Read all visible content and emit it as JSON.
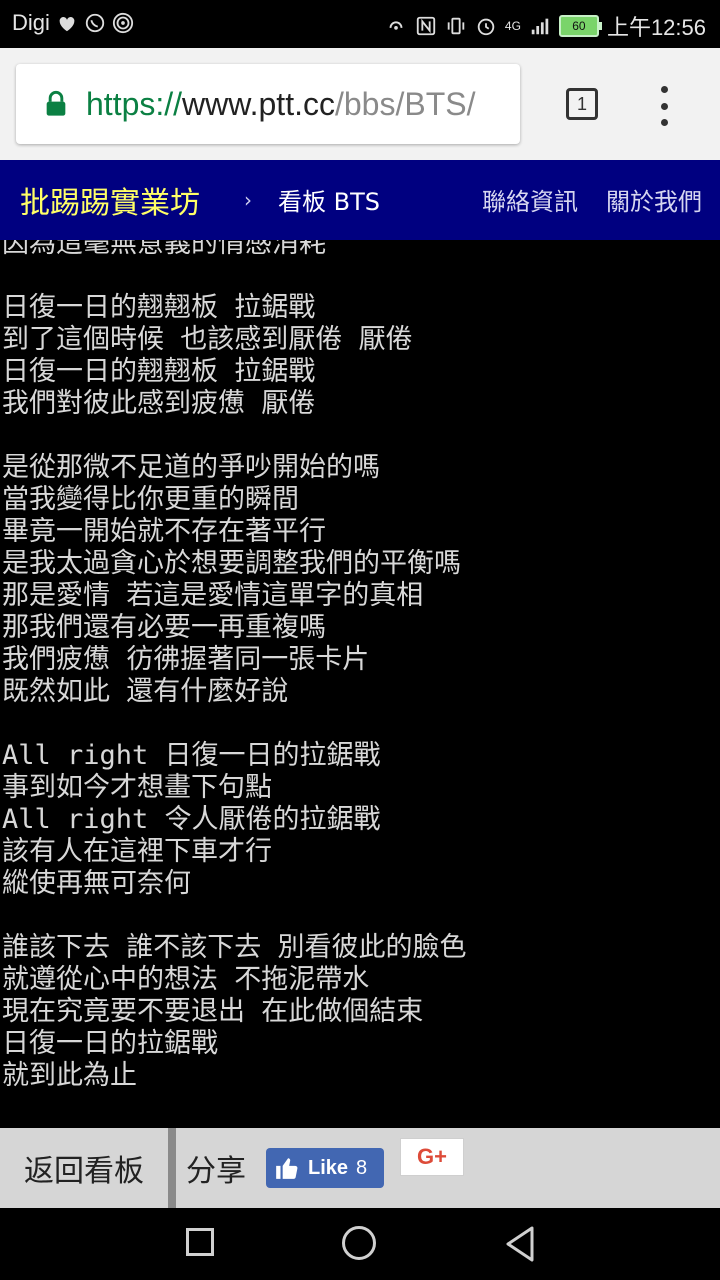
{
  "status_bar": {
    "carrier": "Digi",
    "time": "上午12:56",
    "battery": "60",
    "network": "4G"
  },
  "browser": {
    "url_scheme": "https://",
    "url_host": "www.ptt.cc",
    "url_path": "/bbs/BTS/",
    "tab_count": "1",
    "icons": [
      "lock-icon",
      "tabs-icon",
      "overflow-menu-icon"
    ]
  },
  "site_header": {
    "brand": "批踢踢實業坊",
    "chevron": "›",
    "board": "看板  BTS",
    "nav": [
      "聯絡資訊",
      "關於我們"
    ]
  },
  "content": {
    "lines": [
      "因為這毫無意義的情感消耗",
      "",
      "日復一日的翹翹板 拉鋸戰",
      "到了這個時候 也該感到厭倦 厭倦",
      "日復一日的翹翹板 拉鋸戰",
      "我們對彼此感到疲憊 厭倦",
      "",
      "是從那微不足道的爭吵開始的嗎",
      "當我變得比你更重的瞬間",
      "畢竟一開始就不存在著平行",
      "是我太過貪心於想要調整我們的平衡嗎",
      "那是愛情 若這是愛情這單字的真相",
      "那我們還有必要一再重複嗎",
      "我們疲憊 彷彿握著同一張卡片",
      "既然如此 還有什麼好說",
      "",
      "All right 日復一日的拉鋸戰",
      "事到如今才想畫下句點",
      "All right 令人厭倦的拉鋸戰",
      "該有人在這裡下車才行",
      "縱使再無可奈何",
      "",
      "誰該下去 誰不該下去 別看彼此的臉色",
      "就遵從心中的想法 不拖泥帶水",
      "現在究竟要不要退出 在此做個結束",
      "日復一日的拉鋸戰",
      "就到此為止"
    ]
  },
  "action_bar": {
    "back": "返回看板",
    "share": "分享",
    "fb_like": "Like",
    "fb_count": "8",
    "gplus": "G+"
  },
  "colors": {
    "header_bg": "#000080",
    "brand": "#ffff66",
    "url_green": "#0b8043",
    "fb_blue": "#4267b2",
    "gplus_red": "#dd4b39"
  }
}
